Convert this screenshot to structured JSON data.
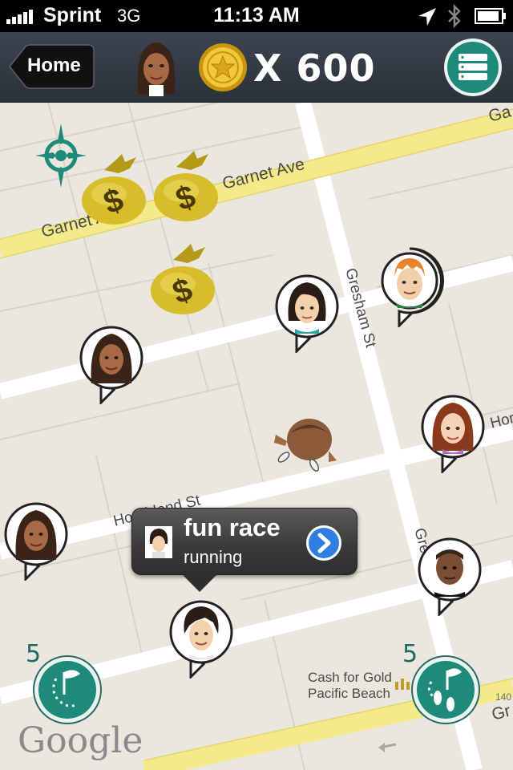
{
  "status_bar": {
    "carrier": "Sprint",
    "network": "3G",
    "time": "11:13 AM"
  },
  "header": {
    "home_label": "Home",
    "coin_count": "X 600"
  },
  "map": {
    "streets": {
      "garnet_right": "Garnet Ave",
      "garnet_left": "Garnet Av",
      "garnet_edge": "Ga",
      "gresham": "Gresham St",
      "gresham_lower": "Gre",
      "hornblend": "Hornblend St",
      "hornblend_right": "Hor",
      "bottom_right": "Gr"
    },
    "poi": {
      "line1": "Cash for Gold",
      "line2": "Pacific Beach"
    },
    "address_number": "140",
    "attribution": "Google"
  },
  "callout": {
    "title": "fun race",
    "status": "running"
  },
  "bottom_controls": {
    "left_count": "5",
    "right_count": "5"
  },
  "colors": {
    "accent_teal": "#1e8a7a",
    "coin_gold": "#e3b21b",
    "callout_arrow_blue": "#2f7fe0"
  }
}
